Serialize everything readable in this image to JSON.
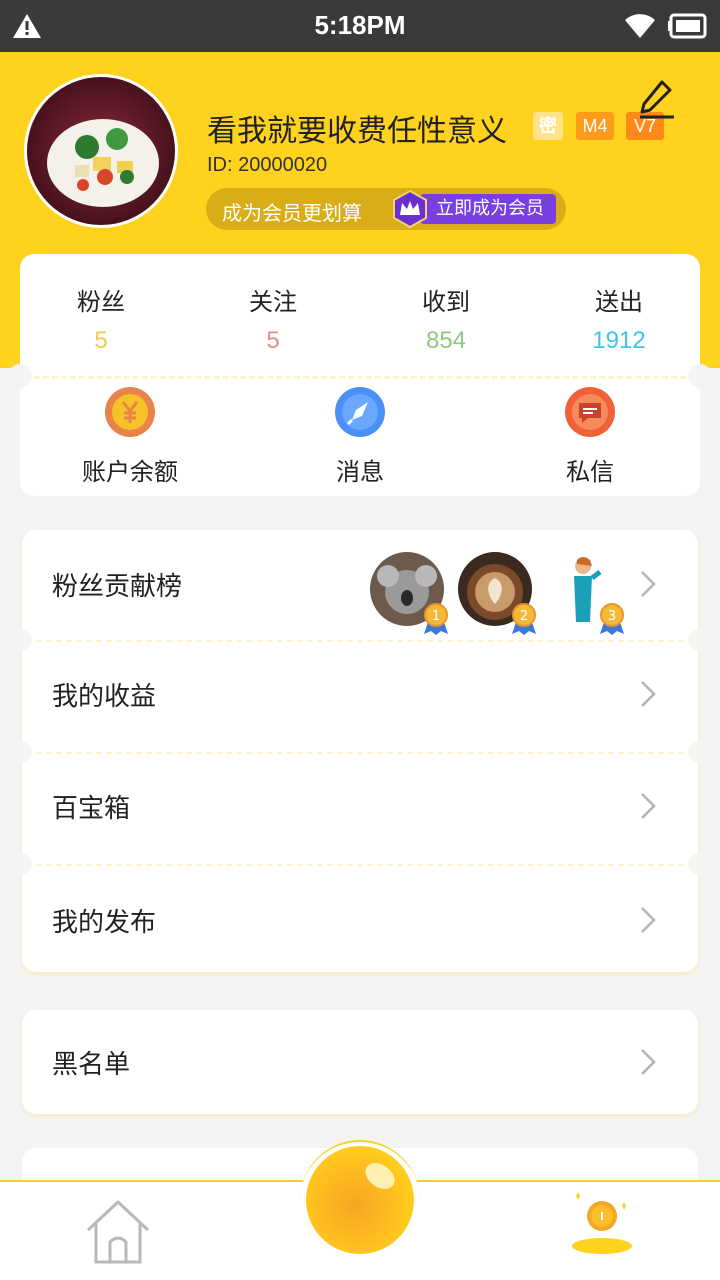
{
  "status_bar": {
    "time": "5:18PM"
  },
  "profile": {
    "username": "看我就要收费任性意义",
    "badges": {
      "secret": "密",
      "m_level": "M4",
      "v_level": "V7"
    },
    "id_text": "ID:  20000020",
    "vip_promo": "成为会员更划算",
    "vip_button": "立即成为会员"
  },
  "stats": [
    {
      "label": "粉丝",
      "value": "5",
      "color": "#f2c84b"
    },
    {
      "label": "关注",
      "value": "5",
      "color": "#e88b8b"
    },
    {
      "label": "收到",
      "value": "854",
      "color": "#8cc97a"
    },
    {
      "label": "送出",
      "value": "1912",
      "color": "#3dc4e8"
    }
  ],
  "quick_actions": [
    {
      "label": "账户余额",
      "icon": "yen-coin-icon",
      "color": "#f5a623"
    },
    {
      "label": "消息",
      "icon": "notification-rocket-icon",
      "color": "#4a8ff5"
    },
    {
      "label": "私信",
      "icon": "chat-bubble-icon",
      "color": "#f2603a"
    }
  ],
  "menu": [
    {
      "label": "粉丝贡献榜"
    },
    {
      "label": "我的收益"
    },
    {
      "label": "百宝箱"
    },
    {
      "label": "我的发布"
    }
  ],
  "fan_ranks": [
    "1",
    "2",
    "3"
  ],
  "blacklist": {
    "label": "黑名单"
  },
  "colors": {
    "brand_yellow": "#ffd21e",
    "vip_purple": "#7a3fe0"
  }
}
